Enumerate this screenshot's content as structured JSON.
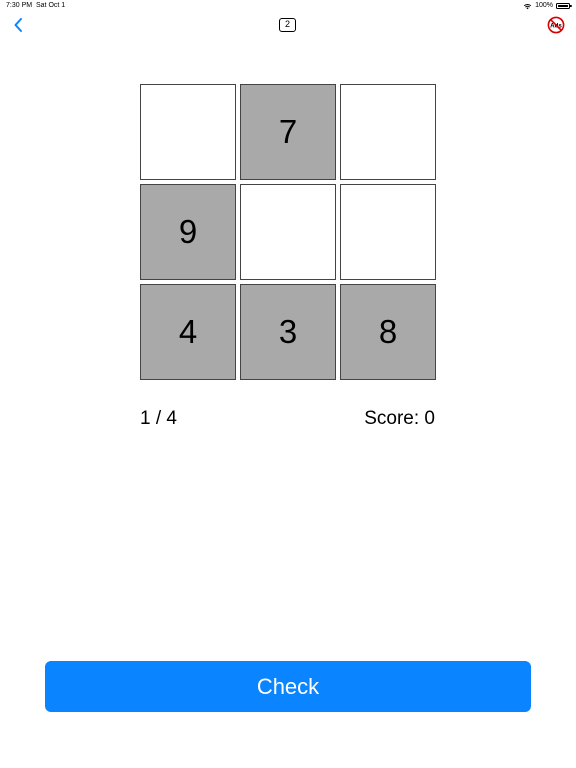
{
  "status_bar": {
    "time": "7:30 PM",
    "date": "Sat Oct 1",
    "battery": "100%",
    "battery_level": 1.0,
    "icons": [
      "wifi-icon",
      "battery-icon"
    ]
  },
  "nav": {
    "back_icon": "chevron-left-icon",
    "level": "2",
    "no_ads_icon": "no-ads-icon",
    "no_ads_text": "Ads",
    "accent": "#0a84ff",
    "no_ads_color": "#d80000"
  },
  "grid": {
    "rows": [
      [
        {
          "value": "",
          "filled": false
        },
        {
          "value": "7",
          "filled": true
        },
        {
          "value": "",
          "filled": false
        }
      ],
      [
        {
          "value": "9",
          "filled": true
        },
        {
          "value": "",
          "filled": false
        },
        {
          "value": "",
          "filled": false
        }
      ],
      [
        {
          "value": "4",
          "filled": true
        },
        {
          "value": "3",
          "filled": true
        },
        {
          "value": "8",
          "filled": true
        }
      ]
    ],
    "filled_color": "#a9a9a9",
    "empty_color": "#ffffff"
  },
  "progress": "1 / 4",
  "score": "Score: 0",
  "check_button": {
    "label": "Check",
    "color": "#0a84ff"
  }
}
